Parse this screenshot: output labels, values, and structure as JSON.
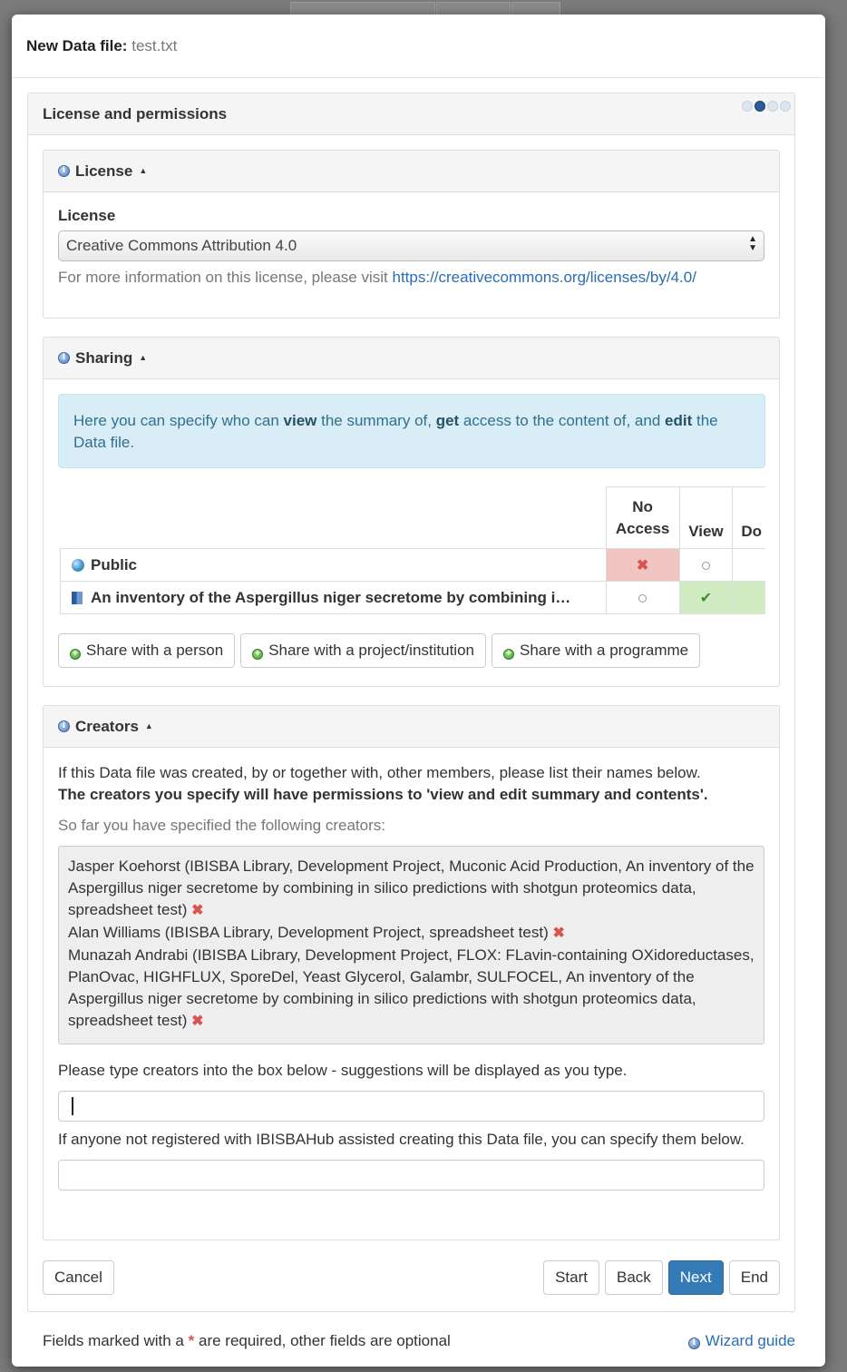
{
  "modal": {
    "title_label": "New Data file:",
    "title_value": "test.txt"
  },
  "wizard": {
    "section_title": "License and permissions",
    "step_count": 4,
    "current_step": 2
  },
  "license": {
    "panel_title": "License",
    "field_label": "License",
    "selected": "Creative Commons Attribution 4.0",
    "help_prefix": "For more information on this license, please visit",
    "help_link": "https://creativecommons.org/licenses/by/4.0/"
  },
  "sharing": {
    "panel_title": "Sharing",
    "info_part1": "Here you can specify who can ",
    "info_view": "view",
    "info_part2": " the summary of, ",
    "info_get": "get",
    "info_part3": " access to the content of, and ",
    "info_edit": "edit",
    "info_part4": " the Data file.",
    "columns": {
      "no_access_line1": "No",
      "no_access_line2": "Access",
      "view": "View",
      "download_partial": "Do"
    },
    "rows": [
      {
        "label": "Public",
        "icon": "globe-icon",
        "selected": "no_access"
      },
      {
        "label": "An inventory of the Aspergillus niger secretome by combining i…",
        "icon": "project-icon",
        "selected": "view"
      }
    ],
    "buttons": {
      "share_person": "Share with a person",
      "share_project": "Share with a project/institution",
      "share_programme": "Share with a programme"
    }
  },
  "creators": {
    "panel_title": "Creators",
    "intro": "If this Data file was created, by or together with, other members, please list their names below.",
    "intro_bold": "The creators you specify will have permissions to 'view and edit summary and contents'.",
    "so_far": "So far you have specified the following creators:",
    "list": [
      "Jasper Koehorst (IBISBA Library, Development Project, Muconic Acid Production, An inventory of the Aspergillus niger secretome by combining in silico predictions with shotgun proteomics data, spreadsheet test)",
      "Alan Williams (IBISBA Library, Development Project, spreadsheet test)",
      "Munazah Andrabi (IBISBA Library, Development Project, FLOX: FLavin-containing OXidoreductases, PlanOvac, HIGHFLUX, SporeDel, Yeast Glycerol, Galambr, SULFOCEL, An inventory of the Aspergillus niger secretome by combining in silico predictions with shotgun proteomics data, spreadsheet test)"
    ],
    "type_hint": "Please type creators into the box below - suggestions will be displayed as you type.",
    "unregistered_hint": "If anyone not registered with IBISBAHub assisted creating this Data file, you can specify them below."
  },
  "nav": {
    "cancel": "Cancel",
    "start": "Start",
    "back": "Back",
    "next": "Next",
    "end": "End"
  },
  "footer": {
    "required_prefix": "Fields marked with a",
    "required_star": "*",
    "required_suffix": "are required, other fields are optional",
    "wizard_guide": "Wizard guide"
  },
  "colors": {
    "primary": "#337ab7",
    "no_access_selected": "#f2c5c5",
    "view_selected": "#d1ecc2",
    "info_bg": "#d9edf7",
    "danger": "#d9534f"
  }
}
